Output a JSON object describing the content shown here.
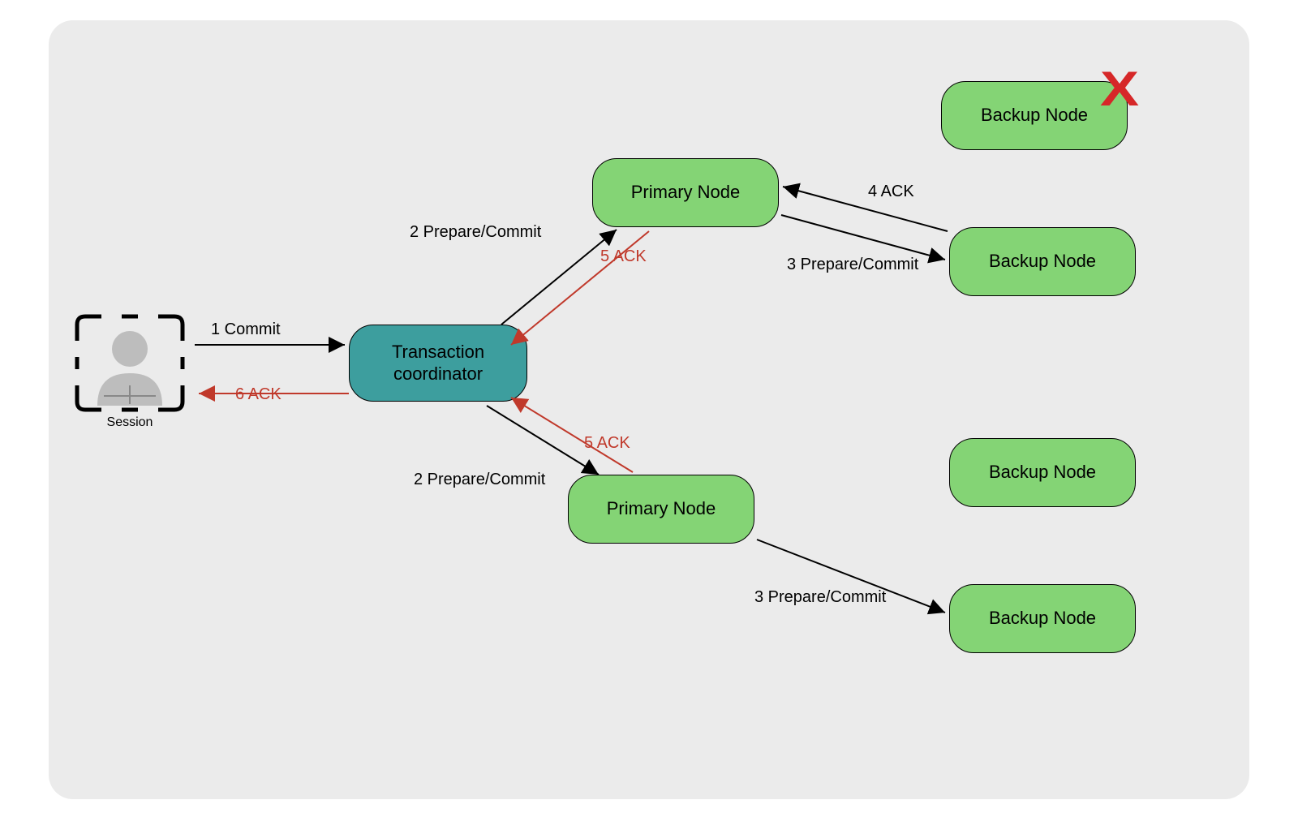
{
  "session_label": "Session",
  "coordinator_label": "Transaction\ncoordinator",
  "primary1_label": "Primary Node",
  "primary2_label": "Primary Node",
  "backup1_failed_label": "Backup Node",
  "backup2_label": "Backup Node",
  "backup3_label": "Backup Node",
  "backup4_label": "Backup Node",
  "edge1": "1 Commit",
  "edge2_top": "2 Prepare/Commit",
  "edge2_bottom": "2 Prepare/Commit",
  "edge3_top": "3 Prepare/Commit",
  "edge3_bottom": "3 Prepare/Commit",
  "edge4": "4 ACK",
  "edge5_top": "5 ACK",
  "edge5_bottom": "5 ACK",
  "edge6": "6 ACK",
  "failure_mark": "X"
}
